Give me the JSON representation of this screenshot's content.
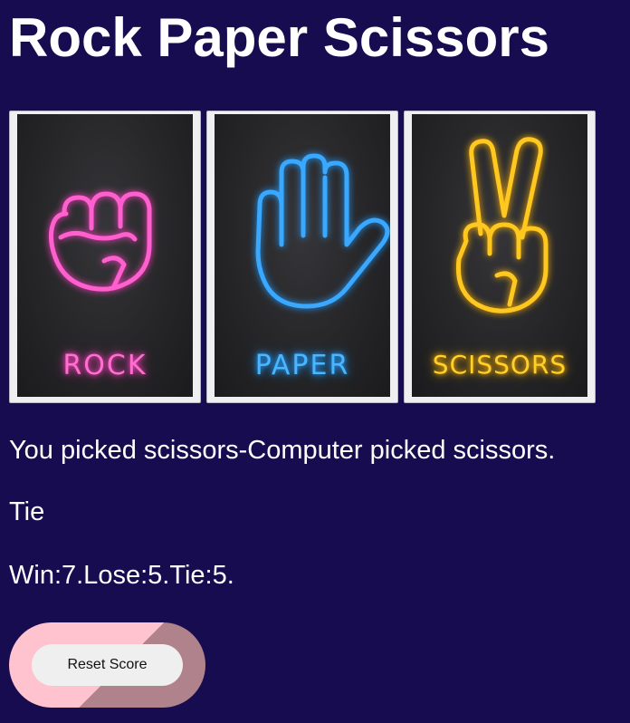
{
  "header": {
    "title": "Rock Paper Scissors"
  },
  "choices": [
    {
      "id": "rock",
      "label": "ROCK",
      "icon": "fist-icon",
      "color": "#ff5fcf"
    },
    {
      "id": "paper",
      "label": "PAPER",
      "icon": "open-hand-icon",
      "color": "#3aa8ff"
    },
    {
      "id": "scissors",
      "label": "SCISSORS",
      "icon": "peace-hand-icon",
      "color": "#ffc820"
    }
  ],
  "result": {
    "message": "You picked scissors-Computer picked scissors.",
    "outcome": "Tie",
    "score": "Win:7.Lose:5.Tie:5."
  },
  "controls": {
    "reset_label": "Reset Score"
  },
  "colors": {
    "background": "#170c50",
    "reset_outer_light": "#ffc3cf",
    "reset_outer_dark": "#b0828b"
  }
}
